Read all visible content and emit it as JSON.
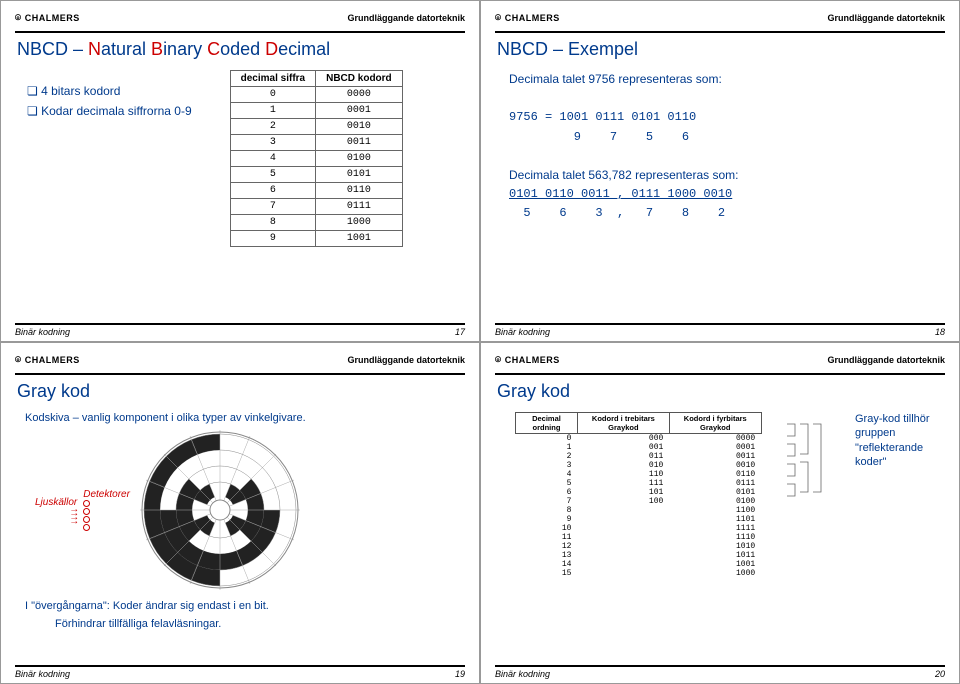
{
  "common": {
    "logo": "CHALMERS",
    "subject": "Grundläggande datorteknik",
    "footer_label": "Binär kodning"
  },
  "s1": {
    "title_parts": [
      "NBCD – ",
      "N",
      "atural ",
      "B",
      "inary ",
      "C",
      "oded ",
      "D",
      "ecimal"
    ],
    "bullets": [
      "4 bitars kodord",
      "Kodar decimala siffrorna 0-9"
    ],
    "th1": "decimal siffra",
    "th2": "NBCD kodord",
    "rows": [
      [
        "0",
        "0000"
      ],
      [
        "1",
        "0001"
      ],
      [
        "2",
        "0010"
      ],
      [
        "3",
        "0011"
      ],
      [
        "4",
        "0100"
      ],
      [
        "5",
        "0101"
      ],
      [
        "6",
        "0110"
      ],
      [
        "7",
        "0111"
      ],
      [
        "8",
        "1000"
      ],
      [
        "9",
        "1001"
      ]
    ],
    "page": "17"
  },
  "s2": {
    "title": "NBCD – Exempel",
    "l1": "Decimala talet 9756 representeras som:",
    "l2": "9756 = 1001 0111 0101 0110",
    "l3": "         9    7    5    6",
    "l4": "Decimala talet 563,782 representeras som:",
    "l5": "0101 0110 0011 , 0111 1000 0010",
    "l6": "  5    6    3  ,   7    8    2",
    "page": "18"
  },
  "s3": {
    "title": "Gray kod",
    "caption": "Kodskiva – vanlig komponent i olika typer av vinkelgivare.",
    "lbl_light": "Ljuskällor",
    "lbl_det": "Detektorer",
    "note1": "I \"övergångarna\": Koder ändrar sig endast i en bit.",
    "note2": "Förhindrar tillfälliga felavläsningar.",
    "page": "19"
  },
  "s4": {
    "title": "Gray kod",
    "th_dec": "Decimal ordning",
    "th_g3": "Kodord i trebitars Graykod",
    "th_g4": "Kodord i fyrbitars Graykod",
    "rows": [
      [
        "0",
        "000",
        "0000"
      ],
      [
        "1",
        "001",
        "0001"
      ],
      [
        "2",
        "011",
        "0011"
      ],
      [
        "3",
        "010",
        "0010"
      ],
      [
        "4",
        "110",
        "0110"
      ],
      [
        "5",
        "111",
        "0111"
      ],
      [
        "6",
        "101",
        "0101"
      ],
      [
        "7",
        "100",
        "0100"
      ],
      [
        "8",
        "",
        "1100"
      ],
      [
        "9",
        "",
        "1101"
      ],
      [
        "10",
        "",
        "1111"
      ],
      [
        "11",
        "",
        "1110"
      ],
      [
        "12",
        "",
        "1010"
      ],
      [
        "13",
        "",
        "1011"
      ],
      [
        "14",
        "",
        "1001"
      ],
      [
        "15",
        "",
        "1000"
      ]
    ],
    "sidenote": "Gray-kod tillhör gruppen \"reflekterande koder\"",
    "page": "20"
  }
}
